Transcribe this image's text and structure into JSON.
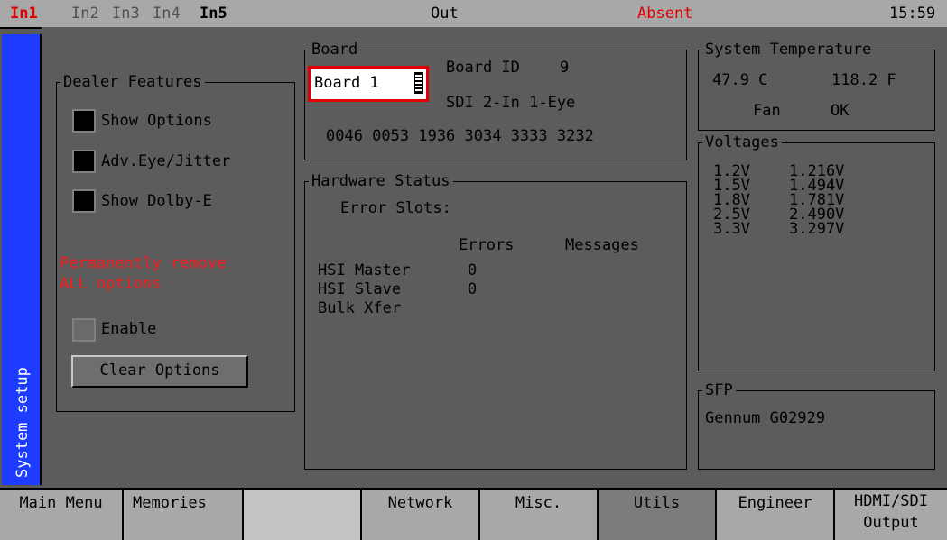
{
  "topbar": {
    "inputs": [
      "In1",
      "In2",
      "In3",
      "In4",
      "In5"
    ],
    "output_label": "Out",
    "status": "Absent",
    "clock": "15:59"
  },
  "sidetab": {
    "label": "System setup"
  },
  "dealer_features": {
    "title": "Dealer Features",
    "show_options": "Show Options",
    "adv_eye_jitter": "Adv.Eye/Jitter",
    "show_dolby": "Show Dolby-E",
    "warning_line1": "Permanently remove",
    "warning_line2": "ALL options",
    "enable": "Enable",
    "clear_button": "Clear Options"
  },
  "board": {
    "title": "Board",
    "selected": "Board 1",
    "board_id_label": "Board ID",
    "board_id_value": "9",
    "board_type": "SDI 2-In 1-Eye",
    "serial": "0046 0053 1936 3034 3333 3232"
  },
  "hardware_status": {
    "title": "Hardware Status",
    "error_slots": "Error Slots:",
    "col_errors": "Errors",
    "col_messages": "Messages",
    "rows": [
      {
        "name": "HSI Master",
        "errors": "0"
      },
      {
        "name": "HSI Slave",
        "errors": "0"
      },
      {
        "name": "Bulk Xfer",
        "errors": ""
      }
    ]
  },
  "system_temperature": {
    "title": "System Temperature",
    "celsius": "47.9 C",
    "fahrenheit": "118.2 F",
    "fan_label": "Fan",
    "fan_status": "OK"
  },
  "voltages": {
    "title": "Voltages",
    "rows": [
      {
        "rail": "1.2V",
        "value": "1.216V"
      },
      {
        "rail": "1.5V",
        "value": "1.494V"
      },
      {
        "rail": "1.8V",
        "value": "1.781V"
      },
      {
        "rail": "2.5V",
        "value": "2.490V"
      },
      {
        "rail": "3.3V",
        "value": "3.297V"
      }
    ]
  },
  "sfp": {
    "title": "SFP",
    "value": "Gennum G02929"
  },
  "menubar": {
    "items": [
      "Main Menu",
      "Memories",
      "",
      "Network",
      "Misc.",
      "Utils",
      "Engineer",
      "HDMI/SDI",
      "Output"
    ]
  },
  "colors": {
    "accent_red": "#ff1a1a",
    "side_tab_blue": "#1d3cff",
    "panel_gray": "#5c5c5c",
    "menu_gray": "#a8a8a8"
  }
}
